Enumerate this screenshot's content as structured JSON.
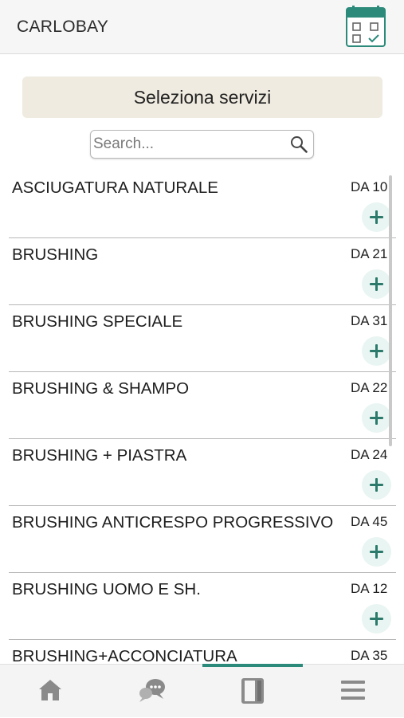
{
  "header": {
    "title": "CARLOBAY",
    "calendar_icon": "calendar-check-icon"
  },
  "banner": {
    "label": "Seleziona servizi"
  },
  "search": {
    "placeholder": "Search...",
    "value": "",
    "icon": "search-icon"
  },
  "services": [
    {
      "name": "ASCIUGATURA NATURALE",
      "price": "DA 10"
    },
    {
      "name": "BRUSHING",
      "price": "DA 21"
    },
    {
      "name": "BRUSHING SPECIALE",
      "price": "DA 31"
    },
    {
      "name": "BRUSHING & SHAMPO",
      "price": "DA 22"
    },
    {
      "name": "BRUSHING + PIASTRA",
      "price": "DA 24"
    },
    {
      "name": "BRUSHING ANTICRESPO PROGRESSIVO",
      "price": "DA 45"
    },
    {
      "name": "BRUSHING UOMO E SH.",
      "price": "DA 12"
    },
    {
      "name": "BRUSHING+ACCONCIATURA",
      "price": "DA 35"
    }
  ],
  "tabs": [
    {
      "id": "home",
      "icon": "home-icon"
    },
    {
      "id": "chat",
      "icon": "chat-icon"
    },
    {
      "id": "booklet",
      "icon": "booklet-icon",
      "active": true
    },
    {
      "id": "menu",
      "icon": "menu-icon"
    }
  ],
  "colors": {
    "accent": "#2b8a7a",
    "banner_bg": "#efebe0",
    "add_button_bg": "#e9f5f2"
  }
}
